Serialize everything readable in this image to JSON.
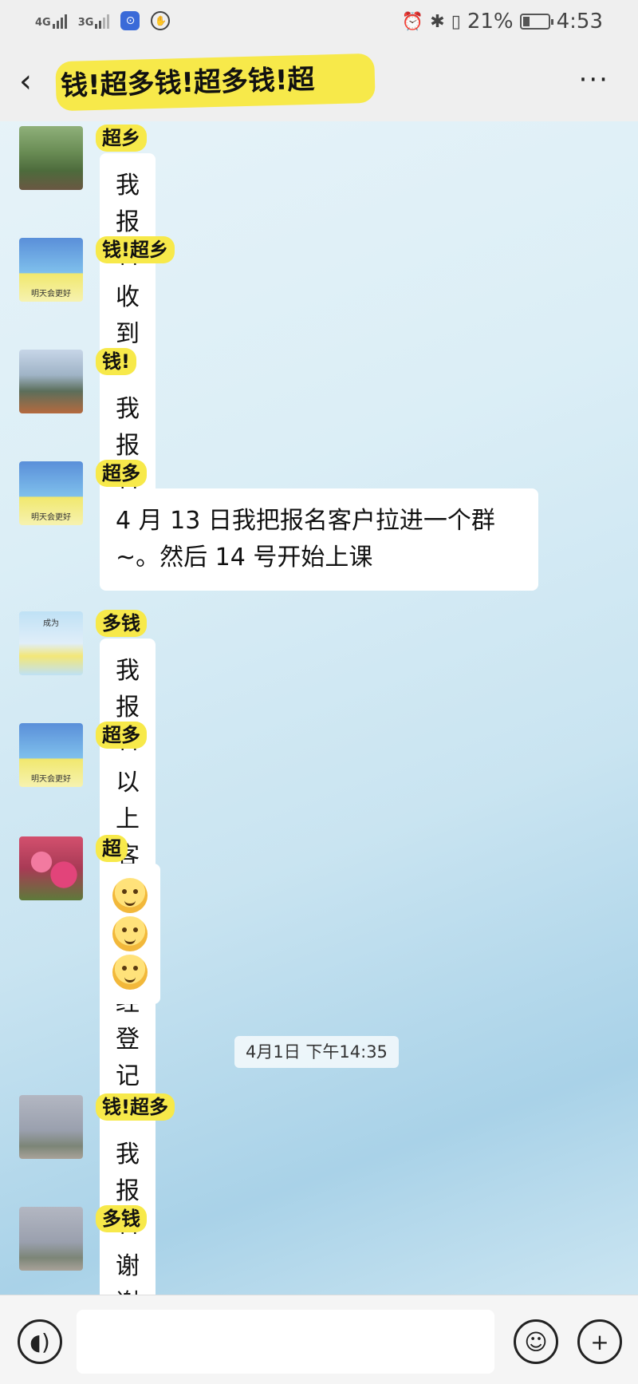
{
  "status_bar": {
    "net1": "4G",
    "net2": "3G",
    "battery": "21%",
    "time": "4:53"
  },
  "header": {
    "title": "钱!超多钱!超多钱!超",
    "more": "···"
  },
  "messages": [
    {
      "name": "超乡",
      "text": "我报名",
      "avatar": "landscape"
    },
    {
      "name": "钱!超乡",
      "text": "收到 ~",
      "avatar": "squirtle",
      "caption": "明天会更好"
    },
    {
      "name": "钱!",
      "text": "我报名",
      "avatar": "beach"
    },
    {
      "name": "超多",
      "text": "4 月 13 日我把报名客户拉进一个群 ~。然后 14 号开始上课",
      "avatar": "squirtle",
      "caption": "明天会更好"
    },
    {
      "name": "多钱",
      "text": "我报名",
      "avatar": "umbrella",
      "caption": "成为"
    },
    {
      "name": "超多",
      "text": "以上客户都已经登记 ~",
      "avatar": "squirtle",
      "caption": "明天会更好"
    },
    {
      "name": "超",
      "emoji_count": 3,
      "avatar": "flowers"
    },
    {
      "name": "钱!超多",
      "text": "我报名",
      "avatar": "sky"
    },
    {
      "name": "多钱",
      "text": "谢谢",
      "avatar": "sky"
    }
  ],
  "timestamp": "4月1日 下午14:35"
}
